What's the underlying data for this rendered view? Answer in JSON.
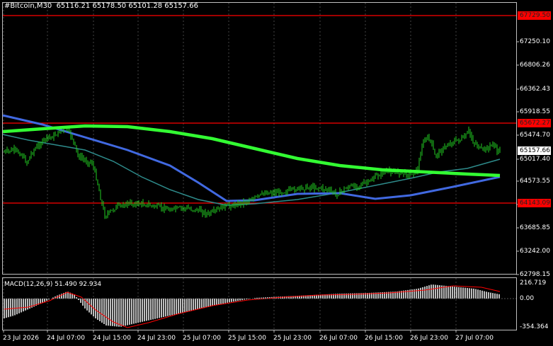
{
  "header": {
    "symbol": "#Bitcoin,M30",
    "ohlc": "65116.21 65178.50 65101.28 65157.66"
  },
  "macd": {
    "label": "MACD(12,26,9) 51.490 92.934",
    "levels": [
      "216.719",
      "0.00",
      "-354.364"
    ]
  },
  "price_axis": {
    "labels": [
      "67250.10",
      "66806.26",
      "66362.43",
      "65918.55",
      "65474.70",
      "65017.40",
      "64573.55",
      "63685.85",
      "63242.00",
      "62798.15"
    ],
    "tags": {
      "resistance_top": "67729.50",
      "resistance_mid": "65672.27",
      "current": "65157.66",
      "support": "64143.09"
    }
  },
  "time_axis": [
    "23 Jul 2026",
    "24 Jul 07:00",
    "24 Jul 15:00",
    "24 Jul 23:00",
    "25 Jul 07:00",
    "25 Jul 15:00",
    "25 Jul 23:00",
    "26 Jul 07:00",
    "26 Jul 15:00",
    "26 Jul 23:00",
    "27 Jul 07:00"
  ],
  "colors": {
    "background": "#000000",
    "grid": "#5a5a5a",
    "candle": "#22cc22",
    "level_line": "#ff0000",
    "ma_fast": "#2e8b8b",
    "ma_mid": "#4169e1",
    "ma_slow": "#33ff33",
    "macd_hist": "#bdbdbd",
    "macd_signal": "#ff0000"
  }
}
